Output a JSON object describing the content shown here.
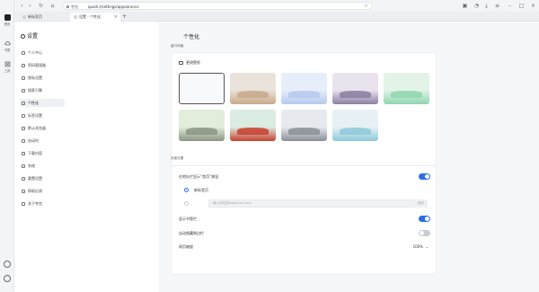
{
  "rail": {
    "items": [
      {
        "label": "首页",
        "icon": "home-icon"
      },
      {
        "label": "书签",
        "icon": "cloud-icon"
      },
      {
        "label": "工具",
        "icon": "tools-icon"
      }
    ]
  },
  "toolbar": {
    "site_label": "夸克",
    "url": "quark://settings/appearance"
  },
  "tabs": [
    {
      "label": "新标签页"
    },
    {
      "label": "设置 - 个性化"
    }
  ],
  "sidebar": {
    "title": "设置",
    "items": [
      {
        "label": "个人中心"
      },
      {
        "label": "密码管理器"
      },
      {
        "label": "隐私设置"
      },
      {
        "label": "搜索引擎"
      },
      {
        "label": "个性化"
      },
      {
        "label": "标签设置"
      },
      {
        "label": "默认浏览器"
      },
      {
        "label": "启动时"
      },
      {
        "label": "下载内容"
      },
      {
        "label": "系统"
      },
      {
        "label": "重置设置"
      },
      {
        "label": "帮助反馈"
      },
      {
        "label": "关于夸克"
      }
    ]
  },
  "main": {
    "title": "个性化",
    "wallpaper_section_label": "窗口风格",
    "wallpaper_header": "更改壁纸",
    "wallpapers": [
      {
        "name": "light-default",
        "colors": [
          "#f8f9fb",
          "#eceef2"
        ]
      },
      {
        "name": "desert",
        "colors": [
          "#e9e3dc",
          "#c8a989"
        ]
      },
      {
        "name": "blue-glass",
        "colors": [
          "#e6eef9",
          "#b5c9ee"
        ]
      },
      {
        "name": "dusk-ridge",
        "colors": [
          "#e9e3ee",
          "#8b7fa1"
        ]
      },
      {
        "name": "green-wave",
        "colors": [
          "#e4f3e8",
          "#8fd6b0"
        ]
      },
      {
        "name": "rocks-green",
        "colors": [
          "#e2eddc",
          "#8a9583"
        ]
      },
      {
        "name": "red-canyon",
        "colors": [
          "#dbece3",
          "#c8402e"
        ]
      },
      {
        "name": "grey-rocks",
        "colors": [
          "#e6e9ee",
          "#8a8f98"
        ]
      },
      {
        "name": "aqua-swirl",
        "colors": [
          "#e7f1f5",
          "#8ec9d9"
        ]
      }
    ],
    "page_section_label": "页面设置",
    "show_home_label": "在地址栏显示“首页”按钮",
    "newtab_option": "新标签页",
    "custom_placeholder": "输入网址如www.xxx.com",
    "save_label": "保存",
    "show_bookmarks_label": "显示书签栏",
    "auto_hide_label": "自动隐藏侧边栏",
    "zoom_label": "网页缩放",
    "zoom_value": "100%",
    "accent_color": "#2a6fe8"
  }
}
